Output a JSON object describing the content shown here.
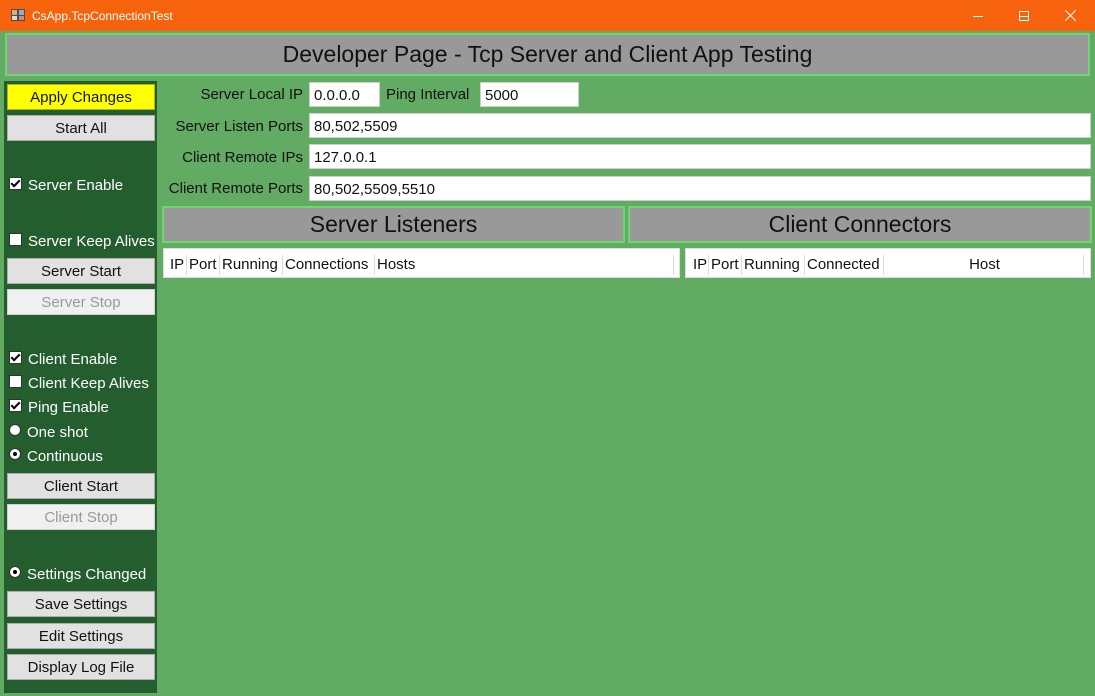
{
  "window": {
    "title": "CsApp.TcpConnectionTest"
  },
  "header": {
    "title": "Developer Page - Tcp Server and Client App Testing"
  },
  "sidebar": {
    "apply_changes": "Apply Changes",
    "start_all": "Start All",
    "server_enable": {
      "label": "Server Enable",
      "checked": true
    },
    "server_keep_alives": {
      "label": "Server Keep Alives",
      "checked": false
    },
    "server_start": "Server Start",
    "server_stop": "Server Stop",
    "client_enable": {
      "label": "Client Enable",
      "checked": true
    },
    "client_keep_alives": {
      "label": "Client Keep Alives",
      "checked": false
    },
    "ping_enable": {
      "label": "Ping Enable",
      "checked": true
    },
    "one_shot": {
      "label": "One shot",
      "selected": false
    },
    "continuous": {
      "label": "Continuous",
      "selected": true
    },
    "client_start": "Client Start",
    "client_stop": "Client Stop",
    "settings_changed": {
      "label": "Settings Changed",
      "selected": true
    },
    "save_settings": "Save Settings",
    "edit_settings": "Edit Settings",
    "display_log_file": "Display Log File"
  },
  "form": {
    "server_local_ip": {
      "label": "Server Local IP",
      "value": "0.0.0.0"
    },
    "ping_interval": {
      "label": "Ping Interval",
      "value": "5000"
    },
    "server_listen_ports": {
      "label": "Server Listen Ports",
      "value": "80,502,5509"
    },
    "client_remote_ips": {
      "label": "Client Remote IPs",
      "value": "127.0.0.1"
    },
    "client_remote_ports": {
      "label": "Client Remote Ports",
      "value": "80,502,5509,5510"
    }
  },
  "server_listeners": {
    "title": "Server Listeners",
    "columns": [
      "IP",
      "Port",
      "Running",
      "Connections",
      "Hosts"
    ]
  },
  "client_connectors": {
    "title": "Client Connectors",
    "columns": [
      "IP",
      "Port",
      "Running",
      "Connected",
      "Host"
    ]
  },
  "colors": {
    "titlebar": "#f7630c",
    "background": "#62ab62",
    "sidebar": "#245e2e",
    "apply_button": "#ffff00",
    "section_header": "#999999",
    "section_border": "#6fd56f"
  }
}
